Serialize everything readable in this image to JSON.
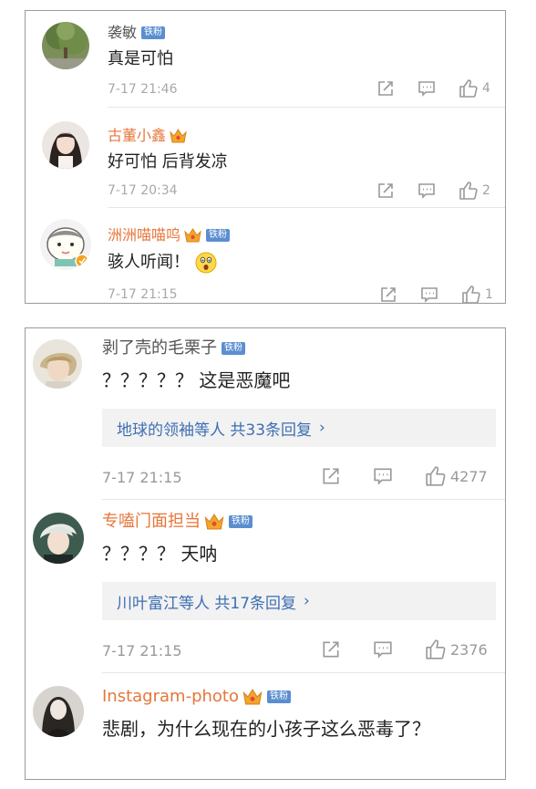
{
  "panel1": {
    "comments": [
      {
        "user": "袭敏",
        "badge": "铁粉",
        "text": "真是可怕",
        "time": "7-17 21:46",
        "likes": "4"
      },
      {
        "user": "古董小鑫",
        "text": "好可怕 后背发凉",
        "time": "7-17 20:34",
        "likes": "2"
      },
      {
        "user": "洲洲喵喵呜",
        "badge": "铁粉",
        "text": "骇人听闻！",
        "time": "7-17 21:15",
        "likes": "1"
      }
    ]
  },
  "panel2": {
    "comments": [
      {
        "user": "剥了壳的毛栗子",
        "badge": "铁粉",
        "text": "？？？？？ 这是恶魔吧",
        "reply": "地球的领袖等人  共33条回复",
        "reply_arrow": "›",
        "time": "7-17 21:15",
        "likes": "4277"
      },
      {
        "user": "专嗑门面担当",
        "badge": "铁粉",
        "text": "？？？？ 天呐",
        "reply": "川叶富江等人  共17条回复",
        "reply_arrow": "›",
        "time": "7-17 21:15",
        "likes": "2376"
      },
      {
        "user": "Instagram-photo",
        "badge": "铁粉",
        "text": "悲剧，为什么现在的小孩子这么恶毒了？"
      }
    ]
  },
  "colors": {
    "gold_name": "#e6763a",
    "badge_blue": "#5b8ed1",
    "reply_link": "#3d6fb2",
    "meta_gray": "#a8a8a8"
  },
  "icons": [
    "repost-icon",
    "comment-icon",
    "like-icon",
    "crown-icon",
    "surprised-emoji-icon"
  ]
}
